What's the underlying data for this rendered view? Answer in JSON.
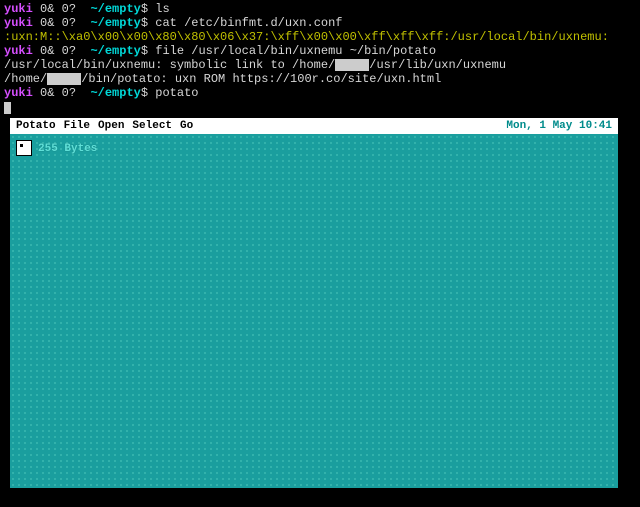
{
  "terminal": {
    "lines": [
      {
        "user": "yuki",
        "status": "0& 0?",
        "cwd": "~/empty",
        "cmd": "ls"
      },
      {
        "user": "yuki",
        "status": "0& 0?",
        "cwd": "~/empty",
        "cmd": "cat /etc/binfmt.d/uxn.conf"
      },
      {
        "out": ":uxn:M::\\xa0\\x00\\x00\\x80\\x80\\x06\\x37:\\xff\\x00\\x00\\xff\\xff\\xff:/usr/local/bin/uxnemu:"
      },
      {
        "user": "yuki",
        "status": "0& 0?",
        "cwd": "~/empty",
        "cmd": "file /usr/local/bin/uxnemu ~/bin/potato"
      },
      {
        "out_parts": [
          "/usr/local/bin/uxnemu: symbolic link to /home/",
          "[REDACT]",
          "/usr/lib/uxn/uxnemu"
        ]
      },
      {
        "out_parts": [
          "/home/",
          "[REDACT]",
          "/bin/potato: uxn ROM https://100r.co/site/uxn.html"
        ]
      },
      {
        "user": "yuki",
        "status": "0& 0?",
        "cwd": "~/empty",
        "cmd": "potato"
      }
    ]
  },
  "potato": {
    "menus": [
      "Potato",
      "File",
      "Open",
      "Select",
      "Go"
    ],
    "clock": "Mon,  1 May 10:41",
    "byte_label": "255 Bytes"
  }
}
